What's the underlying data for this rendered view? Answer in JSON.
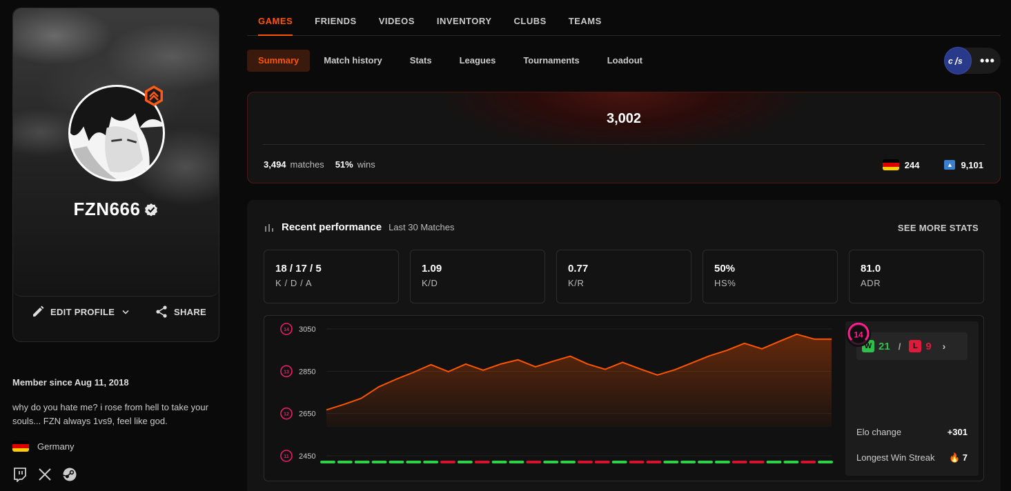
{
  "profile": {
    "username": "FZN666",
    "edit_label": "EDIT PROFILE",
    "share_label": "SHARE",
    "member_since": "Member since Aug 11, 2018",
    "bio": "why do you hate me? i rose from hell to take your souls... FZN always 1vs9, feel like god.",
    "country": "Germany"
  },
  "topnav": [
    "GAMES",
    "FRIENDS",
    "VIDEOS",
    "INVENTORY",
    "CLUBS",
    "TEAMS"
  ],
  "subnav": [
    "Summary",
    "Match history",
    "Stats",
    "Leagues",
    "Tournaments",
    "Loadout"
  ],
  "game_logo": "cs",
  "elo_card": {
    "elo": "3,002",
    "matches_value": "3,494",
    "matches_label": "matches",
    "wins_value": "51%",
    "wins_label": "wins",
    "country_rank": "244",
    "region_rank": "9,101"
  },
  "performance": {
    "title": "Recent performance",
    "subtitle": "Last 30 Matches",
    "see_more": "SEE MORE STATS",
    "stats": [
      {
        "value": "18 / 17 / 5",
        "label": "K / D / A"
      },
      {
        "value": "1.09",
        "label": "K/D"
      },
      {
        "value": "0.77",
        "label": "K/R"
      },
      {
        "value": "50%",
        "label": "HS%"
      },
      {
        "value": "81.0",
        "label": "ADR"
      }
    ],
    "wins": "21",
    "losses": "9",
    "w_badge": "W",
    "l_badge": "L",
    "wl_sep": "/",
    "current_level": "14",
    "elo_change_label": "Elo change",
    "elo_change_value": "+301",
    "streak_label": "Longest Win Streak",
    "streak_value": "7"
  },
  "chart_data": {
    "type": "area",
    "y_ticks": [
      3050,
      2850,
      2650,
      2450
    ],
    "y_tick_levels": [
      "14",
      "13",
      "12",
      "11"
    ],
    "ylim": [
      2450,
      3050
    ],
    "values": [
      2667,
      2693,
      2722,
      2776,
      2812,
      2845,
      2881,
      2848,
      2884,
      2855,
      2884,
      2904,
      2871,
      2897,
      2921,
      2884,
      2859,
      2892,
      2861,
      2832,
      2857,
      2890,
      2923,
      2949,
      2982,
      2956,
      2991,
      3025,
      3002,
      3002
    ],
    "results": [
      "W",
      "W",
      "W",
      "W",
      "W",
      "W",
      "W",
      "L",
      "W",
      "L",
      "W",
      "W",
      "L",
      "W",
      "W",
      "L",
      "L",
      "W",
      "L",
      "L",
      "W",
      "W",
      "W",
      "W",
      "L",
      "L",
      "W",
      "W",
      "L",
      "W"
    ],
    "colors": {
      "line": "#ff5500",
      "win": "#2ed148",
      "loss": "#d4142c"
    }
  },
  "colors": {
    "accent": "#ff5500",
    "win": "#2ec04a",
    "loss": "#e01a3a"
  }
}
